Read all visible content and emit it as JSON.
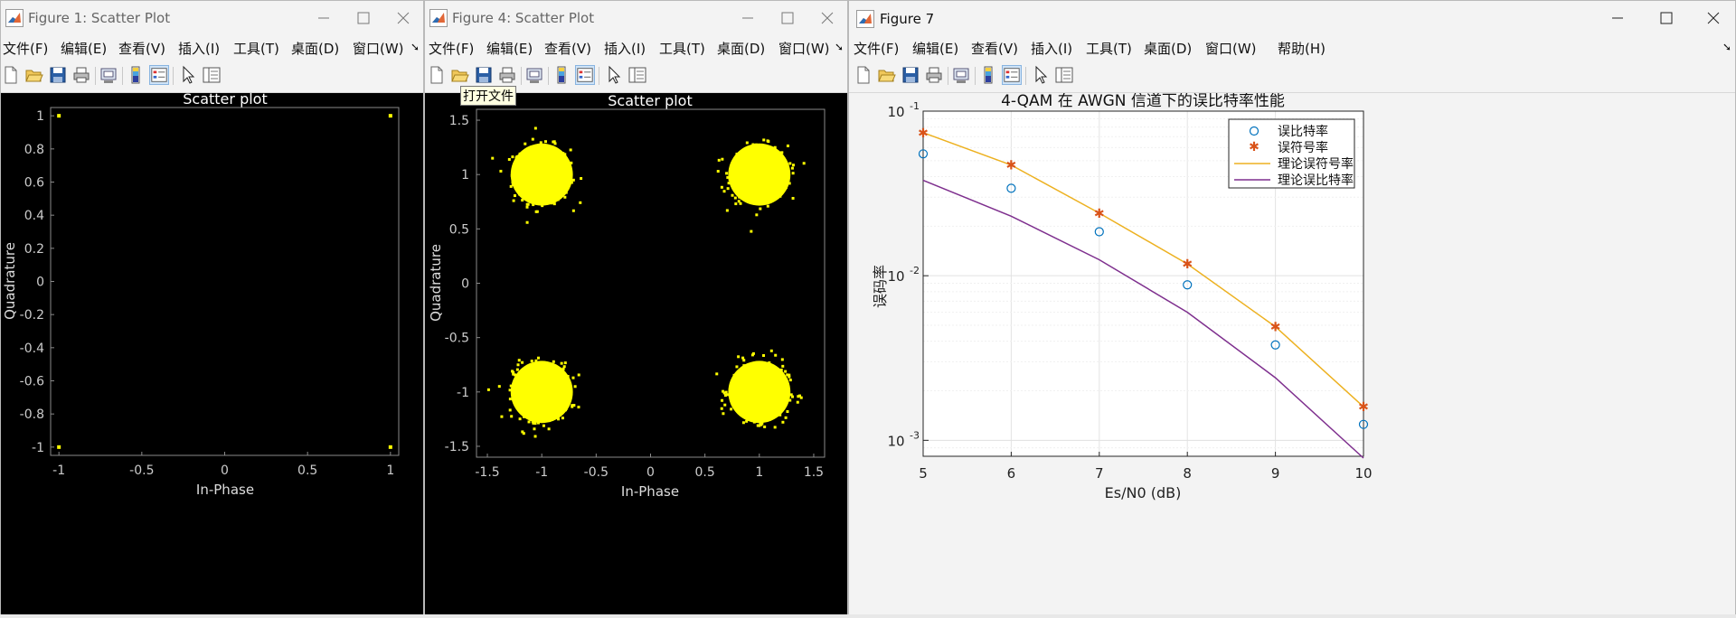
{
  "menu": [
    "文件(F)",
    "编辑(E)",
    "查看(V)",
    "插入(I)",
    "工具(T)",
    "桌面(D)",
    "窗口(W)",
    "帮助(H)"
  ],
  "windows": {
    "fig1": {
      "title": "Figure 1: Scatter Plot",
      "chart": {
        "title": "Scatter plot",
        "xlabel": "In-Phase",
        "ylabel": "Quadrature",
        "xticks": [
          "-1",
          "-0.5",
          "0",
          "0.5",
          "1"
        ],
        "yticks": [
          "1",
          "0.8",
          "0.6",
          "0.4",
          "0.2",
          "0",
          "-0.2",
          "-0.4",
          "-0.6",
          "-0.8",
          "-1"
        ]
      }
    },
    "fig4": {
      "title": "Figure 4: Scatter Plot",
      "tooltip": "打开文件",
      "chart": {
        "title": "Scatter plot",
        "xlabel": "In-Phase",
        "ylabel": "Quadrature",
        "xticks": [
          "-1.5",
          "-1",
          "-0.5",
          "0",
          "0.5",
          "1",
          "1.5"
        ],
        "yticks": [
          "1.5",
          "1",
          "0.5",
          "0",
          "-0.5",
          "-1",
          "-1.5"
        ]
      }
    },
    "fig7": {
      "title": "Figure 7",
      "chart": {
        "title": "4-QAM 在 AWGN 信道下的误比特率性能",
        "xlabel": "Es/N0 (dB)",
        "ylabel": "误码率",
        "xticks": [
          "5",
          "6",
          "7",
          "8",
          "9",
          "10"
        ],
        "legend": [
          "误比特率",
          "误符号率",
          "理论误符号率",
          "理论误比特率"
        ]
      }
    }
  },
  "colors": {
    "scatter_points": "#ffff00",
    "axes_bg_dark": "#000000",
    "orange": "#edb120",
    "purple": "#7e2f8e",
    "blue": "#0072bd",
    "star": "#d95319"
  },
  "chart_data": [
    {
      "type": "scatter",
      "title": "Scatter plot",
      "xlabel": "In-Phase",
      "ylabel": "Quadrature",
      "xlim": [
        -1.05,
        1.05
      ],
      "ylim": [
        -1.05,
        1.05
      ],
      "points": [
        [
          -1,
          1
        ],
        [
          1,
          1
        ],
        [
          -1,
          -1
        ],
        [
          1,
          -1
        ]
      ]
    },
    {
      "type": "scatter",
      "title": "Scatter plot",
      "xlabel": "In-Phase",
      "ylabel": "Quadrature",
      "xlim": [
        -1.6,
        1.6
      ],
      "ylim": [
        -1.6,
        1.6
      ],
      "clusters": [
        {
          "center": [
            -1,
            1
          ],
          "spread": 0.13
        },
        {
          "center": [
            1,
            1
          ],
          "spread": 0.13
        },
        {
          "center": [
            -1,
            -1
          ],
          "spread": 0.13
        },
        {
          "center": [
            1,
            -1
          ],
          "spread": 0.13
        }
      ]
    },
    {
      "type": "line",
      "title": "4-QAM 在 AWGN 信道下的误比特率性能",
      "xlabel": "Es/N0 (dB)",
      "ylabel": "误码率",
      "xlim": [
        5,
        10
      ],
      "ylim": [
        0.0008,
        0.1
      ],
      "yscale": "log",
      "grid": true,
      "legend_position": "top-right",
      "x": [
        5,
        6,
        7,
        8,
        9,
        10
      ],
      "series": [
        {
          "name": "误比特率",
          "marker": "o",
          "values": [
            0.055,
            0.034,
            0.0185,
            0.0088,
            0.0038,
            0.00125
          ]
        },
        {
          "name": "误符号率",
          "marker": "*",
          "values": [
            0.074,
            0.047,
            0.024,
            0.0118,
            0.0049,
            0.0016
          ]
        },
        {
          "name": "理论误符号率",
          "marker": "line",
          "values": [
            0.074,
            0.047,
            0.024,
            0.0118,
            0.0049,
            0.0016
          ]
        },
        {
          "name": "理论误比特率",
          "marker": "line",
          "values": [
            0.038,
            0.023,
            0.0125,
            0.006,
            0.0024,
            0.00078
          ]
        }
      ]
    }
  ]
}
